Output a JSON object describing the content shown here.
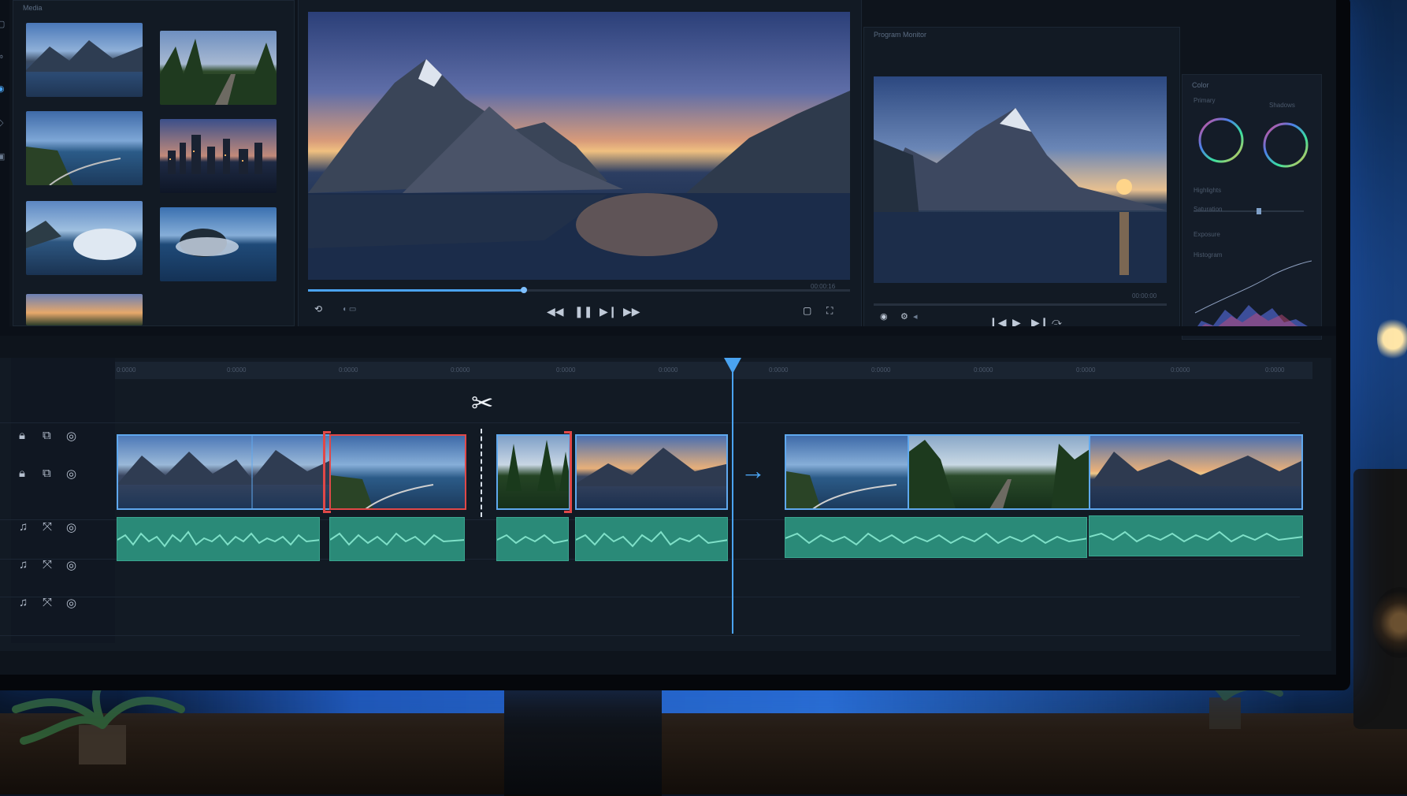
{
  "app": {
    "media_bin_title": "Media",
    "source_title": "",
    "program_title": "Program Monitor",
    "color_title": "Color"
  },
  "media_bin": {
    "thumbnails": [
      "mountain-lake-dusk",
      "forest-road",
      "coastal-highway",
      "city-skyline-night",
      "crashing-wave-cliff",
      "ocean-wave-rock",
      "sunset-forest-valley"
    ]
  },
  "source_monitor": {
    "timecode": "00:00:16",
    "progress": 0.4,
    "controls": [
      "loop-icon",
      "mark-icon",
      "step-back-icon",
      "pause-icon",
      "step-forward-icon",
      "skip-end-icon",
      "safe-margins-icon",
      "fullscreen-icon"
    ]
  },
  "program_monitor": {
    "timecode": "00:00:00",
    "progress": 0.5,
    "controls": [
      "camera-icon",
      "settings-icon",
      "audio-icon",
      "prev-icon",
      "play-icon",
      "next-icon",
      "skip-icon"
    ]
  },
  "color_panel": {
    "labels": [
      "Primary",
      "Shadows",
      "Highlights",
      "Saturation",
      "Exposure",
      "Histogram"
    ],
    "wheels": [
      "lift-wheel",
      "gain-wheel"
    ]
  },
  "timeline": {
    "ticks": [
      "0:0000",
      "0:0000",
      "0:0000",
      "0:0000",
      "0:0000",
      "0:0000",
      "0:0000",
      "0:0000",
      "0:0000",
      "0:0000",
      "0:0000",
      "0:0000"
    ],
    "playhead_fraction": 0.513,
    "tracks": [
      {
        "type": "video",
        "icons": [
          "lock-icon",
          "film-icon",
          "eye-icon"
        ]
      },
      {
        "type": "video",
        "icons": [
          "lock-icon",
          "film-icon",
          "eye-icon"
        ]
      },
      {
        "type": "audio",
        "icons": [
          "music-icon",
          "mute-icon",
          "solo-icon"
        ]
      },
      {
        "type": "audio",
        "icons": [
          "music-icon",
          "mute-icon",
          "solo-icon"
        ]
      },
      {
        "type": "audio",
        "icons": [
          "music-icon",
          "mute-icon",
          "solo-icon"
        ]
      }
    ],
    "video_clips": [
      "mountain-lake",
      "mountain-lake-2",
      "coastal-road",
      "forest-edge",
      "mountain-sunset",
      "coastal-highway",
      "forest-road",
      "mountain-sunrise"
    ],
    "audio_clips": 7,
    "tools": [
      "razor-tool-icon",
      "ripple-arrow-icon"
    ]
  },
  "colors": {
    "accent": "#4aa3f0",
    "trim_handle": "#e04848",
    "audio": "#2a8a78",
    "panel": "#121a24"
  }
}
